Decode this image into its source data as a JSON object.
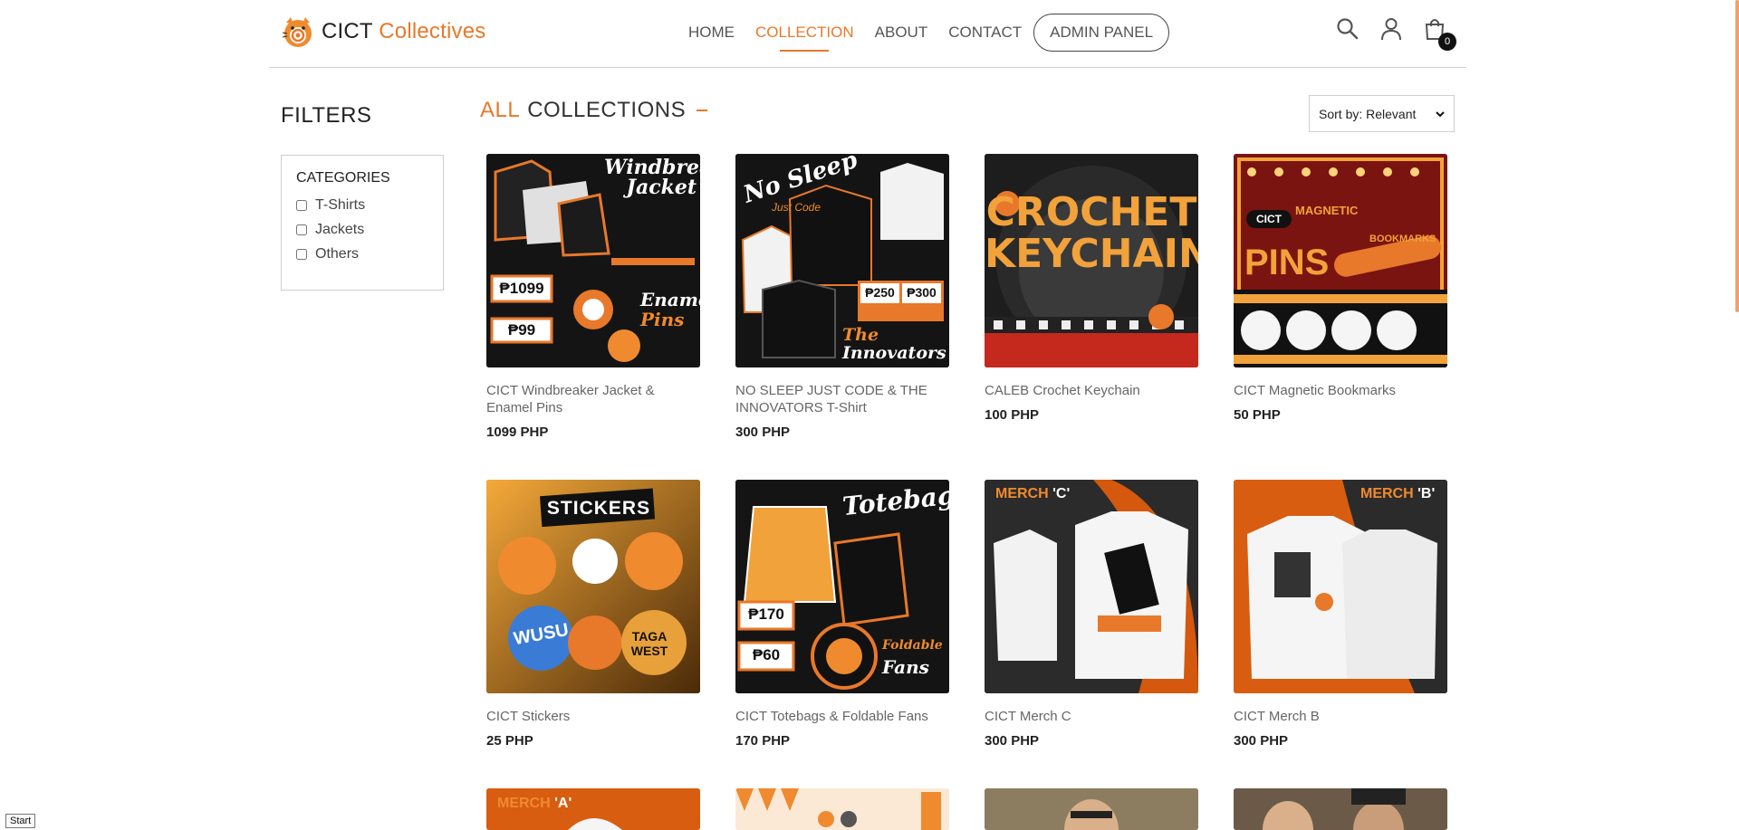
{
  "logo": {
    "word1": "CICT",
    "word2": "Collectives"
  },
  "nav": {
    "links": [
      "HOME",
      "COLLECTION",
      "ABOUT",
      "CONTACT"
    ],
    "active": "COLLECTION",
    "admin_label": "ADMIN PANEL"
  },
  "icons": {
    "search": "search-icon",
    "user": "user-icon",
    "cart": "cart-icon",
    "cart_count": "0"
  },
  "filters": {
    "title": "FILTERS",
    "categories_title": "CATEGORIES",
    "categories": [
      "T-Shirts",
      "Jackets",
      "Others"
    ]
  },
  "page_title": {
    "word1": "ALL",
    "word2": "COLLECTIONS"
  },
  "sort": {
    "selected": "Sort by: Relevant"
  },
  "products": [
    {
      "name": "CICT Windbreaker Jacket & Enamel Pins",
      "price": "1099 PHP",
      "poster": [
        "Windbreaker",
        "Jacket",
        "₱1099",
        "₱99",
        "Enamel",
        "Pins"
      ]
    },
    {
      "name": "NO SLEEP JUST CODE & THE INNOVATORS T-Shirt",
      "price": "300 PHP",
      "poster": [
        "No Sleep",
        "Just Code",
        "₱250",
        "₱300",
        "The",
        "Innovators"
      ]
    },
    {
      "name": "CALEB Crochet Keychain",
      "price": "100 PHP",
      "poster": [
        "CROCHET",
        "KEYCHAIN"
      ]
    },
    {
      "name": "CICT Magnetic Bookmarks",
      "price": "50 PHP",
      "poster": [
        "PINS",
        "MAGNETIC",
        "BOOKMARKS",
        "CICT"
      ]
    },
    {
      "name": "CICT Stickers",
      "price": "25 PHP",
      "poster": [
        "STICKERS",
        "WUSU",
        "TAGA WEST"
      ]
    },
    {
      "name": "CICT Totebags & Foldable Fans",
      "price": "170 PHP",
      "poster": [
        "Totebags",
        "₱170",
        "₱60",
        "Foldable",
        "Fans"
      ]
    },
    {
      "name": "CICT Merch C",
      "price": "300 PHP",
      "poster": [
        "MERCH",
        "'C'"
      ]
    },
    {
      "name": "CICT Merch B",
      "price": "300 PHP",
      "poster": [
        "MERCH",
        "'B'"
      ]
    },
    {
      "poster": [
        "MERCH",
        "'A'"
      ]
    },
    {
      "poster": []
    },
    {
      "poster": []
    },
    {
      "poster": []
    }
  ],
  "taskbar": {
    "start": "Start"
  },
  "colors": {
    "accent": "#e8782a",
    "dark": "#1a1a1a"
  }
}
